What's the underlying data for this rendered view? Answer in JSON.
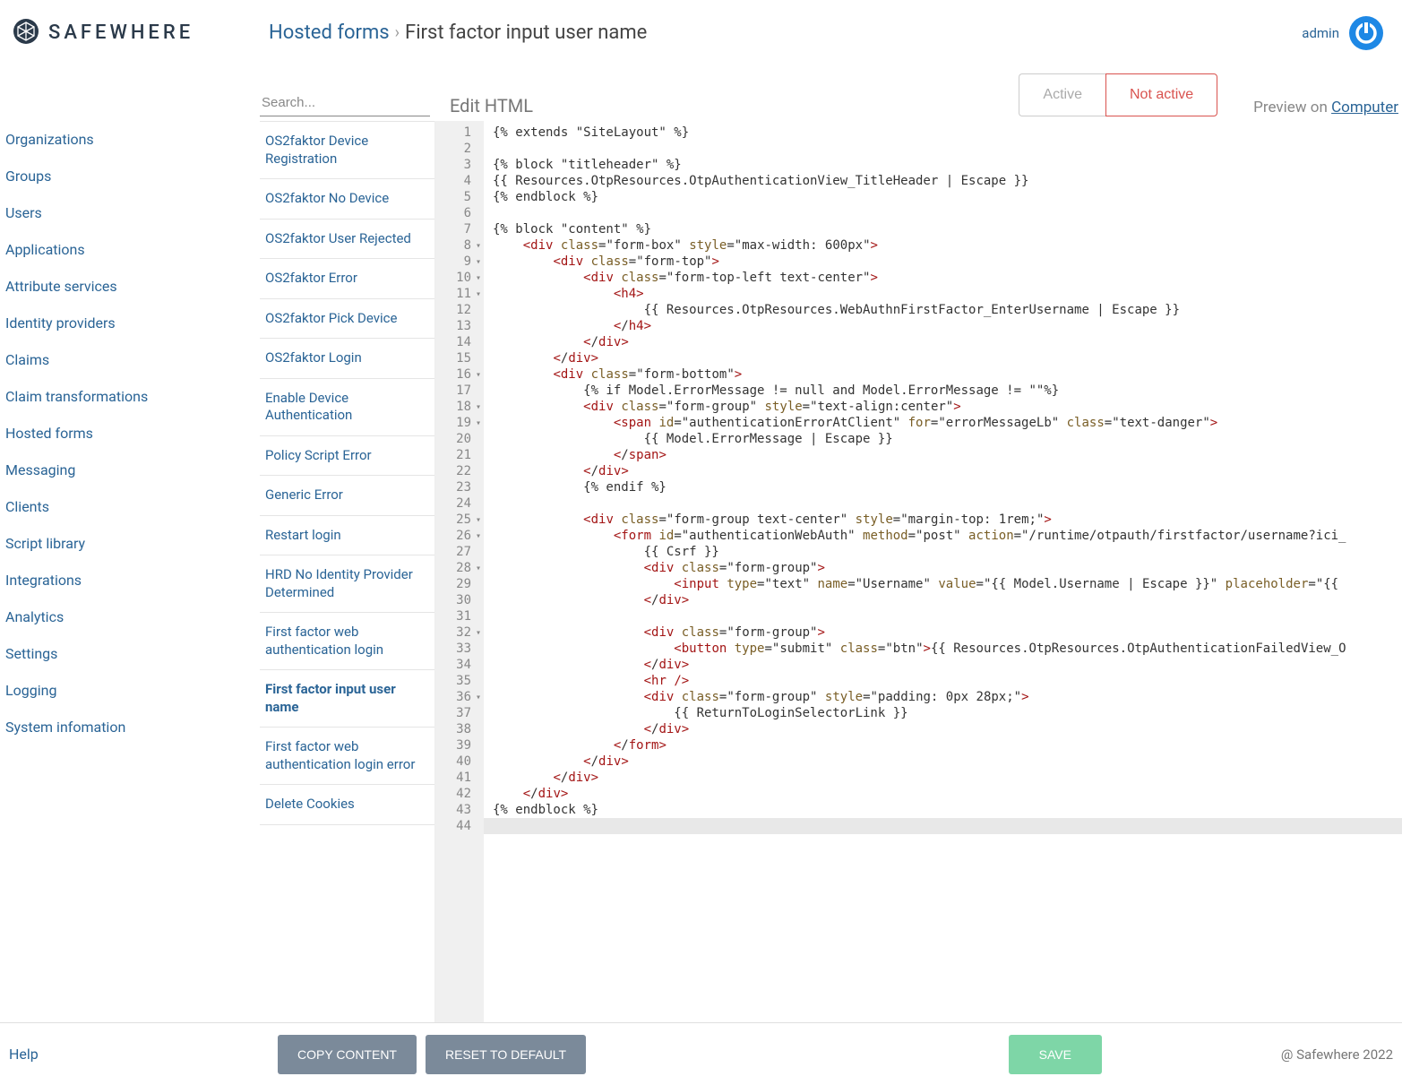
{
  "brand": "SAFEWHERE",
  "breadcrumb": {
    "link": "Hosted forms",
    "sep": "›",
    "current": "First factor input user name"
  },
  "user": {
    "name": "admin"
  },
  "left_nav": [
    "Organizations",
    "Groups",
    "Users",
    "Applications",
    "Attribute services",
    "Identity providers",
    "Claims",
    "Claim transformations",
    "Hosted forms",
    "Messaging",
    "Clients",
    "Script library",
    "Integrations",
    "Analytics",
    "Settings",
    "Logging",
    "System infomation"
  ],
  "search": {
    "placeholder": "Search..."
  },
  "editor_label": "Edit HTML",
  "toggle": {
    "active": "Active",
    "not_active": "Not active"
  },
  "preview": {
    "prefix": "Preview on ",
    "target": "Computer"
  },
  "form_list": [
    {
      "label": "OS2faktor Device Registration"
    },
    {
      "label": "OS2faktor No Device"
    },
    {
      "label": "OS2faktor User Rejected"
    },
    {
      "label": "OS2faktor Error"
    },
    {
      "label": "OS2faktor Pick Device"
    },
    {
      "label": "OS2faktor Login"
    },
    {
      "label": "Enable Device Authentication"
    },
    {
      "label": "Policy Script Error"
    },
    {
      "label": "Generic Error"
    },
    {
      "label": "Restart login"
    },
    {
      "label": "HRD No Identity Provider Determined"
    },
    {
      "label": "First factor web authentication login"
    },
    {
      "label": "First factor input user name",
      "selected": true
    },
    {
      "label": "First factor web authentication login error"
    },
    {
      "label": "Delete Cookies"
    }
  ],
  "code": {
    "fold_lines": [
      8,
      9,
      10,
      11,
      16,
      18,
      19,
      25,
      26,
      28,
      32,
      36
    ],
    "lines": [
      "{% extends \"SiteLayout\" %}",
      "",
      "{% block \"titleheader\" %}",
      "{{ Resources.OtpResources.OtpAuthenticationView_TitleHeader | Escape }}",
      "{% endblock %}",
      "",
      "{% block \"content\" %}",
      "    <div class=\"form-box\" style=\"max-width: 600px\">",
      "        <div class=\"form-top\">",
      "            <div class=\"form-top-left text-center\">",
      "                <h4>",
      "                    {{ Resources.OtpResources.WebAuthnFirstFactor_EnterUsername | Escape }}",
      "                </h4>",
      "            </div>",
      "        </div>",
      "        <div class=\"form-bottom\">",
      "            {% if Model.ErrorMessage != null and Model.ErrorMessage != \"\"%}",
      "            <div class=\"form-group\" style=\"text-align:center\">",
      "                <span id=\"authenticationErrorAtClient\" for=\"errorMessageLb\" class=\"text-danger\">",
      "                    {{ Model.ErrorMessage | Escape }}",
      "                </span>",
      "            </div>",
      "            {% endif %}",
      "",
      "            <div class=\"form-group text-center\" style=\"margin-top: 1rem;\">",
      "                <form id=\"authenticationWebAuth\" method=\"post\" action=\"/runtime/otpauth/firstfactor/username?ici_",
      "                    {{ Csrf }}",
      "                    <div class=\"form-group\">",
      "                        <input type=\"text\" name=\"Username\" value=\"{{ Model.Username | Escape }}\" placeholder=\"{{ ",
      "                    </div>",
      "",
      "                    <div class=\"form-group\">",
      "                        <button type=\"submit\" class=\"btn\">{{ Resources.OtpResources.OtpAuthenticationFailedView_O",
      "                    </div>",
      "                    <hr />",
      "                    <div class=\"form-group\" style=\"padding: 0px 28px;\">",
      "                        {{ ReturnToLoginSelectorLink }}",
      "                    </div>",
      "                </form>",
      "            </div>",
      "        </div>",
      "    </div>",
      "{% endblock %}",
      ""
    ]
  },
  "footer": {
    "help": "Help",
    "copy": "COPY CONTENT",
    "reset": "RESET TO DEFAULT",
    "save": "SAVE",
    "copyright": "@ Safewhere 2022"
  }
}
